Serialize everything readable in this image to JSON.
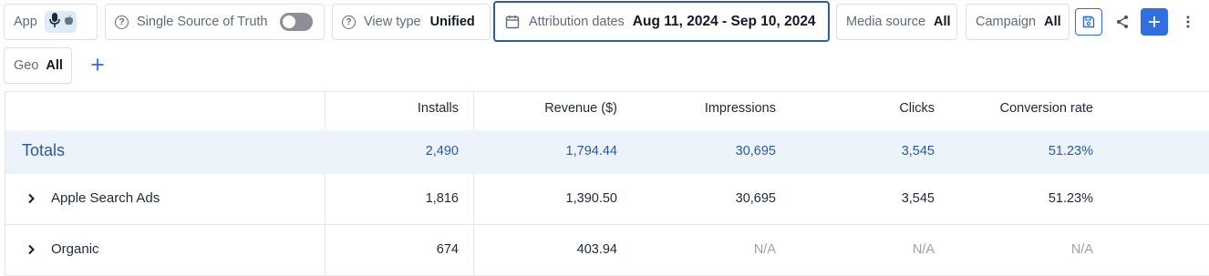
{
  "filters": {
    "app": {
      "label": "App"
    },
    "sst": {
      "label": "Single Source of Truth",
      "toggle_on": false
    },
    "view_type": {
      "label": "View type",
      "value": "Unified"
    },
    "attribution": {
      "label": "Attribution dates",
      "value": "Aug 11, 2024 - Sep 10, 2024"
    },
    "media_source": {
      "label": "Media source",
      "value": "All"
    },
    "campaign": {
      "label": "Campaign",
      "value": "All"
    },
    "geo": {
      "label": "Geo",
      "value": "All"
    }
  },
  "icons": {
    "app_badge": [
      "microphone-icon",
      "apple-icon"
    ],
    "help": "question-circle-icon",
    "calendar": "calendar-icon",
    "save": "save-icon",
    "share": "share-icon",
    "add": "plus-icon",
    "more": "kebab-menu-icon",
    "add_filter": "plus-icon",
    "expand": "chevron-right-icon"
  },
  "colors": {
    "accent": "#2f6fe0",
    "totals_bg": "#edf3fb",
    "totals_text": "#2b5a9c"
  },
  "table": {
    "columns": [
      "Installs",
      "Revenue ($)",
      "Impressions",
      "Clicks",
      "Conversion rate"
    ],
    "totals": {
      "name": "Totals",
      "values": [
        "2,490",
        "1,794.44",
        "30,695",
        "3,545",
        "51.23%"
      ]
    },
    "rows": [
      {
        "name": "Apple Search Ads",
        "values": [
          "1,816",
          "1,390.50",
          "30,695",
          "3,545",
          "51.23%"
        ]
      },
      {
        "name": "Organic",
        "values": [
          "674",
          "403.94",
          "N/A",
          "N/A",
          "N/A"
        ]
      }
    ]
  }
}
